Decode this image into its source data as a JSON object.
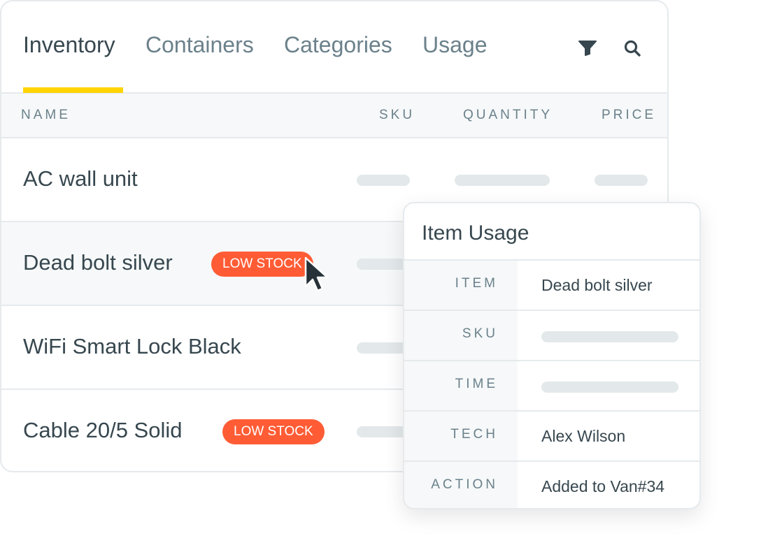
{
  "tabs": [
    {
      "label": "Inventory",
      "active": true
    },
    {
      "label": "Containers",
      "active": false
    },
    {
      "label": "Categories",
      "active": false
    },
    {
      "label": "Usage",
      "active": false
    }
  ],
  "toolbar": {
    "filter_icon": "filter-icon",
    "search_icon": "search-icon"
  },
  "accent_color": "#ffd400",
  "badge_color": "#ff5c35",
  "table": {
    "columns": [
      "NAME",
      "SKU",
      "QUANTITY",
      "PRICE"
    ],
    "rows": [
      {
        "name": "AC wall unit",
        "badge": null
      },
      {
        "name": "Dead bolt silver",
        "badge": "LOW STOCK"
      },
      {
        "name": "WiFi Smart Lock Black",
        "badge": null
      },
      {
        "name": "Cable 20/5 Solid",
        "badge": "LOW STOCK"
      }
    ]
  },
  "popup": {
    "title": "Item Usage",
    "fields": [
      {
        "label": "ITEM",
        "value": "Dead bolt silver"
      },
      {
        "label": "SKU",
        "value": null
      },
      {
        "label": "TIME",
        "value": null
      },
      {
        "label": "TECH",
        "value": "Alex Wilson"
      },
      {
        "label": "ACTION",
        "value": "Added to Van#34"
      }
    ]
  }
}
